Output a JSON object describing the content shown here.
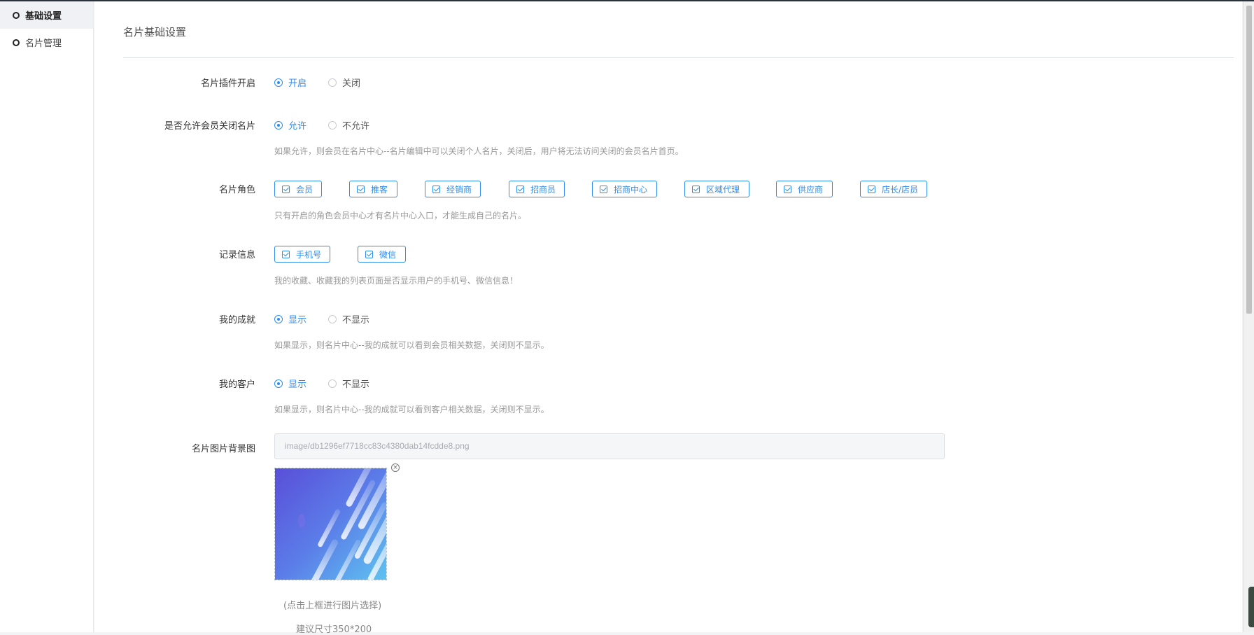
{
  "sidebar": {
    "items": [
      {
        "label": "基础设置",
        "active": true
      },
      {
        "label": "名片管理",
        "active": false
      }
    ]
  },
  "page": {
    "title": "名片基础设置"
  },
  "form": {
    "plugin_enable": {
      "label": "名片插件开启",
      "options": [
        "开启",
        "关闭"
      ],
      "selected": "开启"
    },
    "allow_member_close": {
      "label": "是否允许会员关闭名片",
      "options": [
        "允许",
        "不允许"
      ],
      "selected": "允许",
      "hint": "如果允许，则会员在名片中心--名片编辑中可以关闭个人名片，关闭后，用户将无法访问关闭的会员名片首页。"
    },
    "card_roles": {
      "label": "名片角色",
      "options": [
        "会员",
        "推客",
        "经销商",
        "招商员",
        "招商中心",
        "区域代理",
        "供应商",
        "店长/店员"
      ],
      "checked": [
        "会员",
        "推客",
        "经销商",
        "招商员",
        "招商中心",
        "区域代理",
        "供应商",
        "店长/店员"
      ],
      "hint": "只有开启的角色会员中心才有名片中心入口，才能生成自己的名片。"
    },
    "record_info": {
      "label": "记录信息",
      "options": [
        "手机号",
        "微信"
      ],
      "checked": [
        "手机号",
        "微信"
      ],
      "hint": "我的收藏、收藏我的列表页面是否显示用户的手机号、微信信息！"
    },
    "my_achievement": {
      "label": "我的成就",
      "options": [
        "显示",
        "不显示"
      ],
      "selected": "显示",
      "hint": "如果显示，则名片中心--我的成就可以看到会员相关数据，关闭则不显示。"
    },
    "my_customers": {
      "label": "我的客户",
      "options": [
        "显示",
        "不显示"
      ],
      "selected": "显示",
      "hint": "如果显示，则名片中心--我的成就可以看到客户相关数据，关闭则不显示。"
    },
    "background_image": {
      "label": "名片图片背景图",
      "path_value": "image/db1296ef7718cc83c4380dab14fcdde8.png",
      "select_caption": "(点击上框进行图片选择)",
      "size_caption": "建议尺寸350*200"
    }
  },
  "colors": {
    "accent": "#2d8cf0",
    "hint_text": "#999999",
    "sidebar_bg": "#ffffff"
  }
}
